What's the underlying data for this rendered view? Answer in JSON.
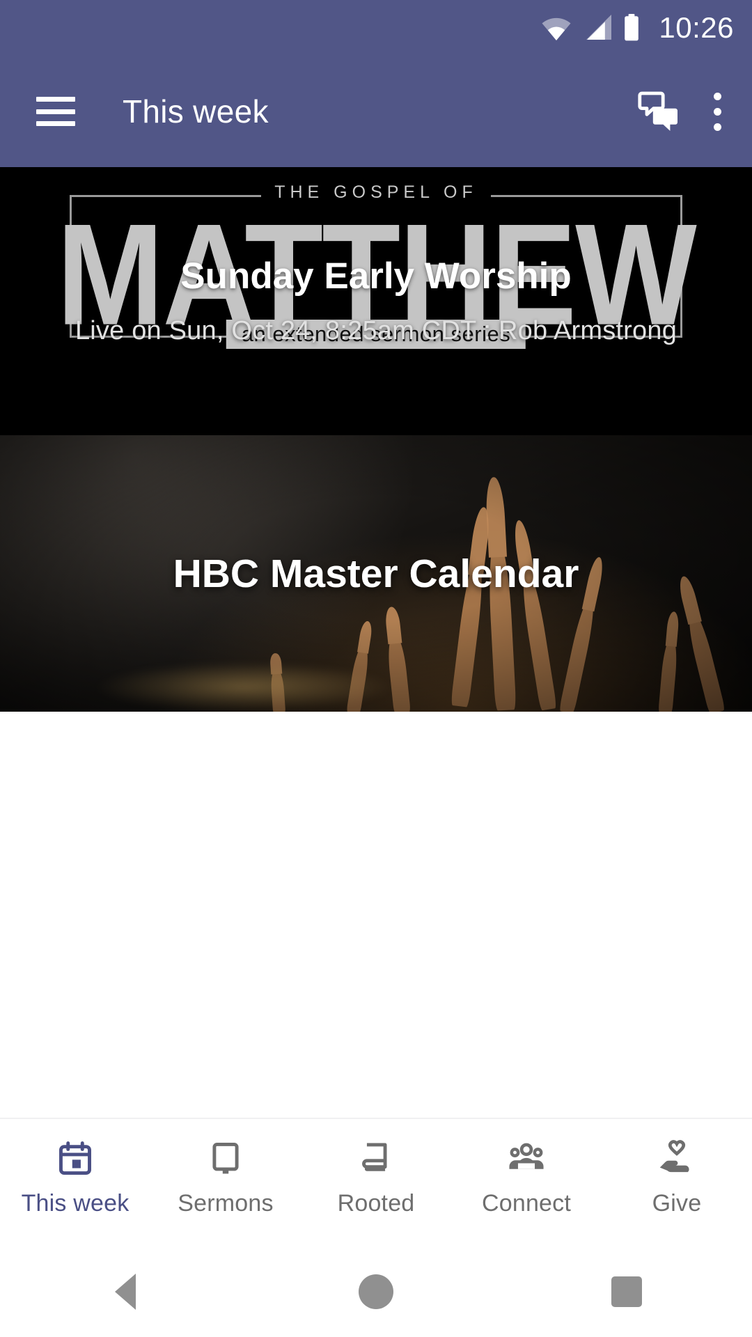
{
  "status_bar": {
    "time": "10:26",
    "icons": [
      "wifi-icon",
      "cellular-signal-icon",
      "battery-icon"
    ]
  },
  "app_bar": {
    "menu_icon": "hamburger-menu-icon",
    "title": "This week",
    "chat_icon": "chat-bubbles-icon",
    "overflow_icon": "more-vertical-icon",
    "background_color": "#515687"
  },
  "feed": {
    "cards": [
      {
        "id": "sunday-early-worship",
        "title": "Sunday Early Worship",
        "subtitle": "Live on Sun, Oct 24, 8:25am CDT : Rob Armstrong",
        "artwork": {
          "kicker": "THE GOSPEL OF",
          "wordmark": "MATTHEW",
          "tagline": "an extended sermon series",
          "background_color": "#000000"
        }
      },
      {
        "id": "hbc-master-calendar",
        "title": "HBC Master Calendar",
        "subtitle": "",
        "artwork": {
          "description": "dark worship photo with raised hands",
          "background_color": "#151311"
        }
      }
    ]
  },
  "bottom_nav": {
    "active_color": "#4a4f85",
    "inactive_color": "#6e6e6e",
    "items": [
      {
        "label": "This week",
        "icon": "calendar-icon",
        "active": true
      },
      {
        "label": "Sermons",
        "icon": "monitor-icon",
        "active": false
      },
      {
        "label": "Rooted",
        "icon": "book-icon",
        "active": false
      },
      {
        "label": "Connect",
        "icon": "people-group-icon",
        "active": false
      },
      {
        "label": "Give",
        "icon": "hand-heart-icon",
        "active": false
      }
    ]
  },
  "android_nav": {
    "back": "back-triangle-icon",
    "home": "home-circle-icon",
    "recents": "recents-square-icon"
  }
}
